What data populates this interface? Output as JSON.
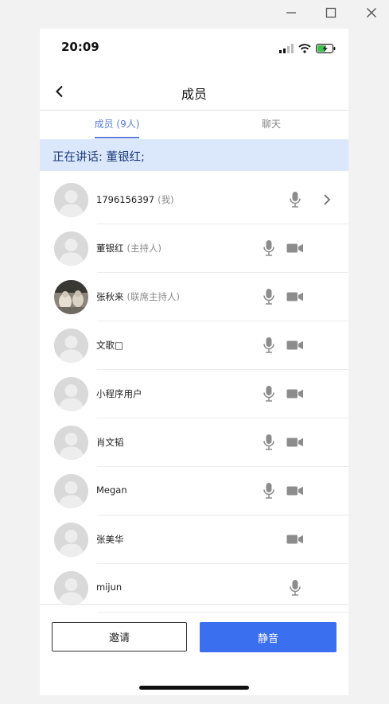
{
  "window": {
    "controls": [
      "minimize-icon",
      "maximize-icon",
      "close-icon"
    ]
  },
  "status_bar": {
    "time": "20:09",
    "icons": [
      "signal-icon",
      "wifi-icon",
      "battery-charging-icon"
    ]
  },
  "nav": {
    "title": "成员",
    "back_icon": "back-chevron-icon"
  },
  "tabs": [
    {
      "label": "成员 (9人)",
      "selected": true
    },
    {
      "label": "聊天",
      "selected": false
    }
  ],
  "speaking": {
    "text": "正在讲话: 董银红;"
  },
  "members": [
    {
      "name": "1796156397",
      "tag": "(我)",
      "mic": true,
      "camera": false,
      "chevron": true,
      "photo": false
    },
    {
      "name": "董银红",
      "tag": "(主持人)",
      "mic": true,
      "camera": true,
      "chevron": false,
      "photo": false
    },
    {
      "name": "张秋来",
      "tag": "(联席主持人)",
      "mic": true,
      "camera": true,
      "chevron": false,
      "photo": true
    },
    {
      "name": "文歌□",
      "tag": "",
      "mic": true,
      "camera": true,
      "chevron": false,
      "photo": false
    },
    {
      "name": "小程序用户",
      "tag": "",
      "mic": true,
      "camera": true,
      "chevron": false,
      "photo": false
    },
    {
      "name": "肖文韬",
      "tag": "",
      "mic": true,
      "camera": true,
      "chevron": false,
      "photo": false
    },
    {
      "name": "Megan",
      "tag": "",
      "mic": true,
      "camera": true,
      "chevron": false,
      "photo": false
    },
    {
      "name": "张美华",
      "tag": "",
      "mic": false,
      "camera": true,
      "chevron": false,
      "photo": false
    },
    {
      "name": "mijun",
      "tag": "",
      "mic": true,
      "camera": false,
      "chevron": false,
      "photo": false
    }
  ],
  "actions": {
    "invite_label": "邀请",
    "mute_label": "静音"
  },
  "colors": {
    "accent": "#3a6ff0",
    "tab_active": "#5b7fd6",
    "speaking_bg": "#dbe8fb",
    "icon_gray": "#8c8c8c"
  }
}
